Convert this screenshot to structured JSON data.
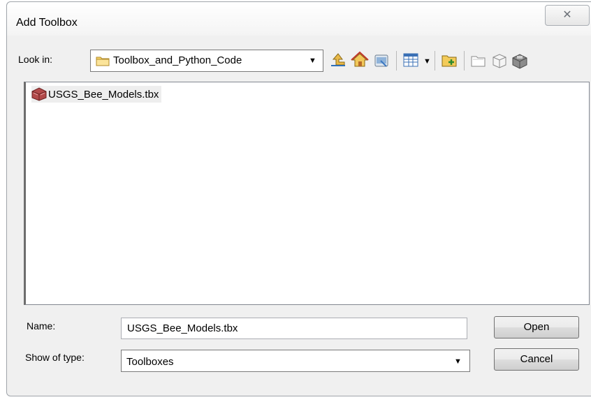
{
  "window": {
    "title": "Add Toolbox",
    "close_glyph": "✕"
  },
  "lookin": {
    "label": "Look in:",
    "value": "Toolbox_and_Python_Code"
  },
  "toolbar": {
    "icons": [
      "up-one-level-icon",
      "home-icon",
      "connect-folder-icon",
      "view-list-icon",
      "new-folder-icon",
      "new-item-icon",
      "new-toolbox-icon",
      "toolbox-icon"
    ]
  },
  "files": [
    {
      "name": "USGS_Bee_Models.tbx",
      "icon": "toolbox-icon"
    }
  ],
  "name_field": {
    "label": "Name:",
    "value": "USGS_Bee_Models.tbx"
  },
  "type_field": {
    "label": "Show of type:",
    "value": "Toolboxes"
  },
  "buttons": {
    "open": "Open",
    "cancel": "Cancel"
  },
  "colors": {
    "dialog_bg": "#f0f0f0",
    "folder_yellow": "#f7d46a",
    "toolbox_red": "#a33b3b"
  }
}
